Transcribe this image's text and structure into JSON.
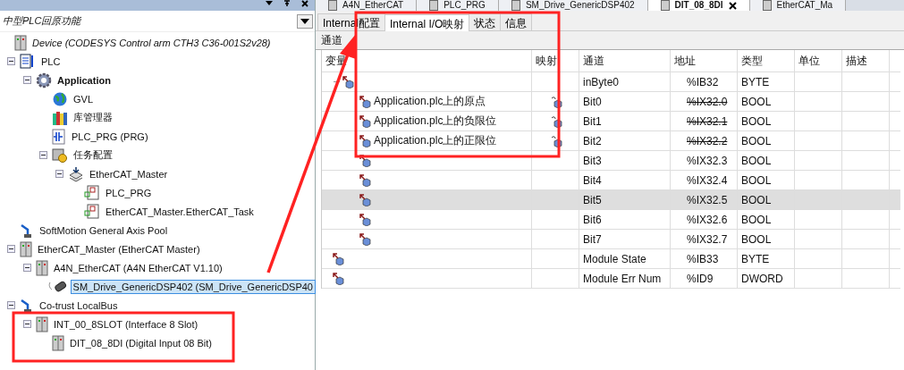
{
  "left_pane": {
    "header": "中型PLC回原功能",
    "tree": [
      {
        "label": "Device (CODESYS Control arm CTH3 C36-001S2v28)",
        "kind": "device",
        "italic": true,
        "selected": false,
        "children": [
          {
            "label": "PLC",
            "kind": "plc",
            "selected": false,
            "expanded": true,
            "children": [
              {
                "label": "Application",
                "kind": "app",
                "bold": true,
                "selected": false,
                "expanded": true,
                "children": [
                  {
                    "label": "GVL",
                    "kind": "gvl",
                    "selected": false
                  },
                  {
                    "label": "库管理器",
                    "kind": "library",
                    "selected": false
                  },
                  {
                    "label": "PLC_PRG (PRG)",
                    "kind": "prg",
                    "selected": false
                  },
                  {
                    "label": "任务配置",
                    "kind": "taskconfig",
                    "selected": false,
                    "expanded": true,
                    "children": [
                      {
                        "label": "EtherCAT_Master",
                        "kind": "task",
                        "selected": false,
                        "expanded": true,
                        "children": [
                          {
                            "label": "PLC_PRG",
                            "kind": "pou",
                            "selected": false
                          },
                          {
                            "label": "EtherCAT_Master.EtherCAT_Task",
                            "kind": "pou",
                            "selected": false
                          }
                        ]
                      }
                    ]
                  }
                ]
              }
            ]
          },
          {
            "label": "SoftMotion General Axis Pool",
            "kind": "axis",
            "selected": false
          },
          {
            "label": "EtherCAT_Master (EtherCAT Master)",
            "kind": "device",
            "selected": false,
            "expanded": true,
            "children": [
              {
                "label": "A4N_EtherCAT (A4N EtherCAT V1.10)",
                "kind": "device",
                "selected": false,
                "expanded": true,
                "children": [
                  {
                    "label": "SM_Drive_GenericDSP402 (SM_Drive_GenericDSP40",
                    "kind": "drive",
                    "selected": true
                  }
                ]
              }
            ]
          },
          {
            "label": "Co-trust LocalBus",
            "kind": "axis",
            "selected": false,
            "expanded": true,
            "children": [
              {
                "label": "INT_00_8SLOT (Interface 8 Slot)",
                "kind": "device",
                "selected": false,
                "expanded": true,
                "children": [
                  {
                    "label": "DIT_08_8DI (Digital Input 08 Bit)",
                    "kind": "device",
                    "selected": false
                  }
                ]
              }
            ]
          }
        ]
      }
    ]
  },
  "editor_tabs": [
    {
      "label": "A4N_EtherCAT",
      "selected": false
    },
    {
      "label": "PLC_PRG",
      "selected": false
    },
    {
      "label": "SM_Drive_GenericDSP402",
      "selected": false
    },
    {
      "label": "DIT_08_8DI",
      "selected": true
    },
    {
      "label": "EtherCAT_Ma",
      "selected": false
    }
  ],
  "sub_tabs": [
    {
      "label": "Internal配置",
      "selected": false
    },
    {
      "label": "Internal I/O映射",
      "selected": true
    },
    {
      "label": "状态",
      "selected": false
    },
    {
      "label": "信息",
      "selected": false
    }
  ],
  "section_label": "通道",
  "table": {
    "columns": [
      "变量",
      "映射",
      "通道",
      "地址",
      "类型",
      "单位",
      "描述"
    ],
    "rows": [
      {
        "mapped": false,
        "channel": "inByte0",
        "address": "%IB32",
        "type": "BYTE",
        "selected": false,
        "expanded": true,
        "children": [
          {
            "variable": "Application.plc上的原点",
            "mapped": true,
            "channel": "Bit0",
            "address": "%IX32.0",
            "type": "BOOL",
            "selected": false
          },
          {
            "variable": "Application.plc上的负限位",
            "mapped": true,
            "channel": "Bit1",
            "address": "%IX32.1",
            "type": "BOOL",
            "selected": false
          },
          {
            "variable": "Application.plc上的正限位",
            "mapped": true,
            "channel": "Bit2",
            "address": "%IX32.2",
            "type": "BOOL",
            "selected": false
          },
          {
            "mapped": false,
            "channel": "Bit3",
            "address": "%IX32.3",
            "type": "BOOL",
            "selected": false
          },
          {
            "mapped": false,
            "channel": "Bit4",
            "address": "%IX32.4",
            "type": "BOOL",
            "selected": false
          },
          {
            "mapped": false,
            "channel": "Bit5",
            "address": "%IX32.5",
            "type": "BOOL",
            "selected": true
          },
          {
            "mapped": false,
            "channel": "Bit6",
            "address": "%IX32.6",
            "type": "BOOL",
            "selected": false
          },
          {
            "mapped": false,
            "channel": "Bit7",
            "address": "%IX32.7",
            "type": "BOOL",
            "selected": false
          }
        ]
      },
      {
        "mapped": false,
        "channel": "Module State",
        "address": "%IB33",
        "type": "BYTE",
        "selected": false
      },
      {
        "mapped": false,
        "channel": "Module Err Num",
        "address": "%ID9",
        "type": "DWORD",
        "selected": false
      }
    ]
  }
}
